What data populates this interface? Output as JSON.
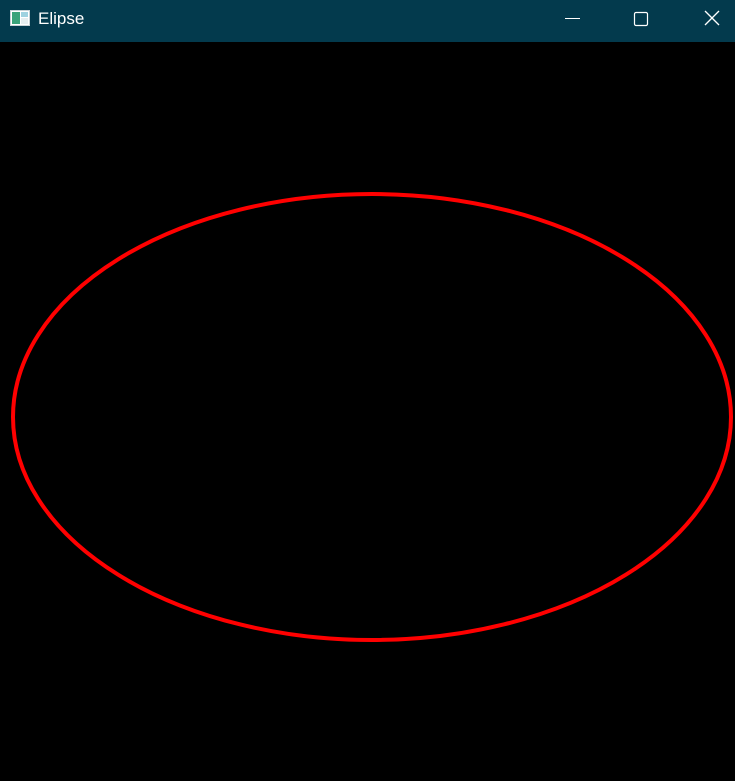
{
  "window": {
    "title": "Elipse",
    "icon": "app-window-icon",
    "controls": {
      "minimize_icon": "minimize-icon",
      "maximize_icon": "maximize-icon",
      "close_icon": "close-icon"
    }
  },
  "colors": {
    "titlebar": "#033a4d",
    "canvas_background": "#000000",
    "ellipse_stroke": "#ff0000"
  },
  "canvas": {
    "shape": "ellipse"
  }
}
